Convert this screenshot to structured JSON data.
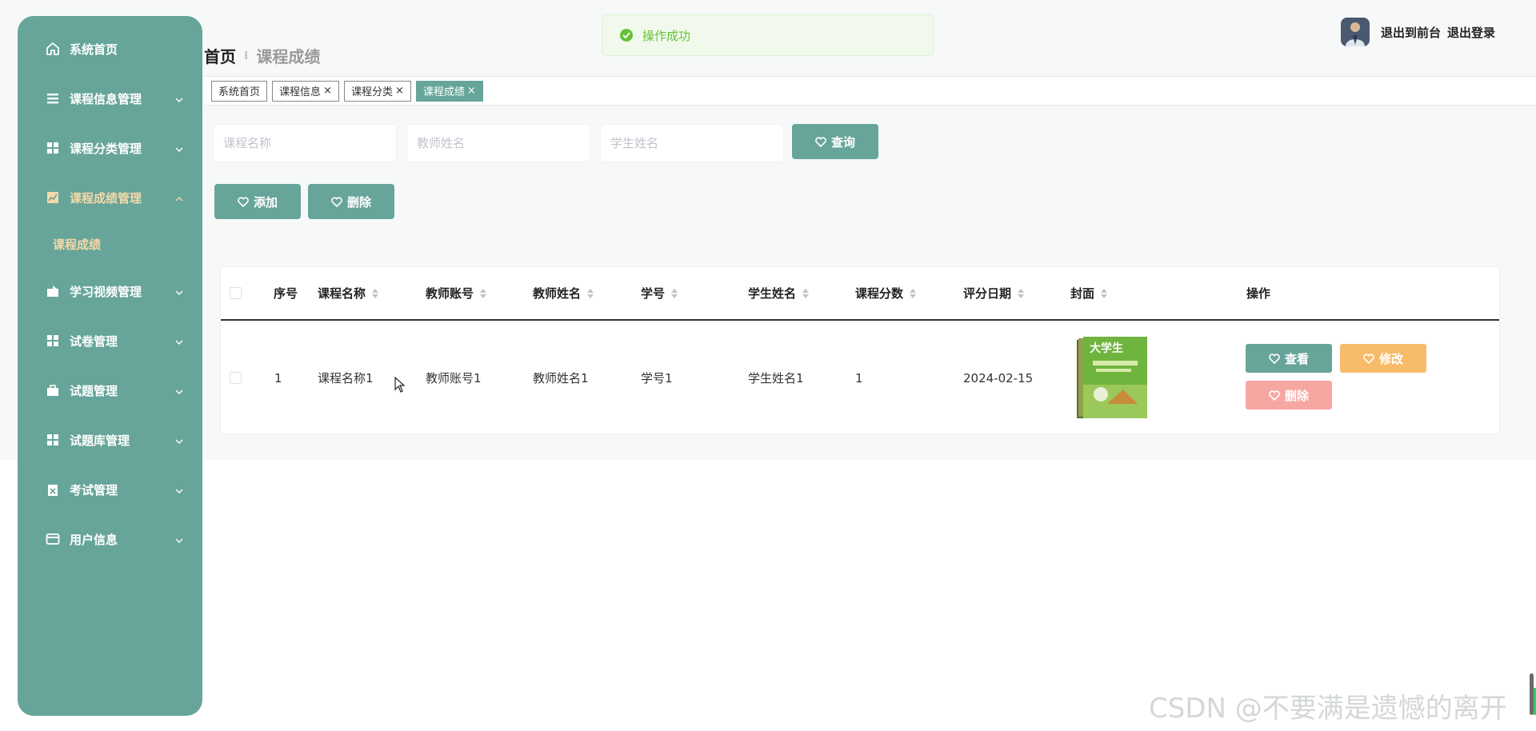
{
  "sidebar": {
    "items": [
      {
        "label": "系统首页",
        "icon": "home-icon",
        "expandable": false,
        "expanded": false
      },
      {
        "label": "课程信息管理",
        "icon": "list-icon",
        "expandable": true,
        "expanded": false
      },
      {
        "label": "课程分类管理",
        "icon": "grid-icon",
        "expandable": true,
        "expanded": false
      },
      {
        "label": "课程成绩管理",
        "icon": "chart-icon",
        "expandable": true,
        "expanded": true
      },
      {
        "label": "学习视频管理",
        "icon": "video-icon",
        "expandable": true,
        "expanded": false
      },
      {
        "label": "试卷管理",
        "icon": "grid-icon",
        "expandable": true,
        "expanded": false
      },
      {
        "label": "试题管理",
        "icon": "briefcase-icon",
        "expandable": true,
        "expanded": false
      },
      {
        "label": "试题库管理",
        "icon": "grid-icon",
        "expandable": true,
        "expanded": false
      },
      {
        "label": "考试管理",
        "icon": "clipboard-icon",
        "expandable": true,
        "expanded": false
      },
      {
        "label": "用户信息",
        "icon": "card-icon",
        "expandable": true,
        "expanded": false
      }
    ],
    "subitem": "课程成绩",
    "active_color": "#f6d9a9",
    "bg_color": "#67a59a"
  },
  "header": {
    "breadcrumb_home": "首页",
    "breadcrumb_current": "课程成绩",
    "logout_front": "退出到前台",
    "logout": "退出登录"
  },
  "toast": {
    "message": "操作成功",
    "color": "#67c23a"
  },
  "tags": [
    {
      "label": "系统首页",
      "closable": false,
      "active": false
    },
    {
      "label": "课程信息",
      "closable": true,
      "active": false
    },
    {
      "label": "课程分类",
      "closable": true,
      "active": false
    },
    {
      "label": "课程成绩",
      "closable": true,
      "active": true
    }
  ],
  "search": {
    "course_name_placeholder": "课程名称",
    "teacher_name_placeholder": "教师姓名",
    "student_name_placeholder": "学生姓名",
    "query_label": "查询"
  },
  "actions": {
    "add_label": "添加",
    "delete_label": "删除"
  },
  "table": {
    "headers": [
      "序号",
      "课程名称",
      "教师账号",
      "教师姓名",
      "学号",
      "学生姓名",
      "课程分数",
      "评分日期",
      "封面",
      "操作"
    ],
    "rows": [
      {
        "index": "1",
        "course_name": "课程名称1",
        "teacher_account": "教师账号1",
        "teacher_name": "教师姓名1",
        "student_no": "学号1",
        "student_name": "学生姓名1",
        "score": "1",
        "date": "2024-02-15",
        "cover_text": "大学生"
      }
    ],
    "row_actions": {
      "view": "查看",
      "edit": "修改",
      "delete": "删除"
    },
    "action_colors": {
      "view": "#67a59a",
      "edit": "#f8bb6a",
      "delete": "#f7a7a1"
    }
  },
  "watermark": "CSDN @不要满是遗憾的离开"
}
